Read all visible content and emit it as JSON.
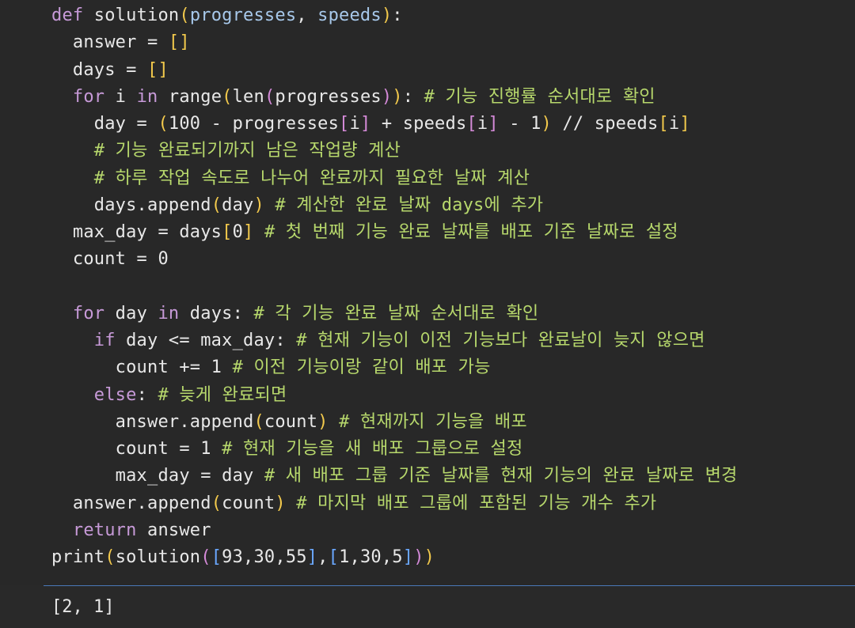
{
  "theme": {
    "background": "#282828",
    "output_background": "#292929",
    "divider": "#4a78b8",
    "colors": {
      "keyword": "#c79ad8",
      "function": "#e6e6e6",
      "param": "#a7c8ea",
      "bracket1": "#f2c94c",
      "bracket2": "#d48ad8",
      "bracket3": "#6aa7ff",
      "comment": "#b7d86c",
      "number": "#d8d8d8",
      "text": "#e8e8e8"
    }
  },
  "code_lines": [
    [
      {
        "t": "def",
        "c": "keyword"
      },
      {
        "t": " solution",
        "c": "function"
      },
      {
        "t": "(",
        "c": "bracket1"
      },
      {
        "t": "progresses",
        "c": "param"
      },
      {
        "t": ", ",
        "c": "text"
      },
      {
        "t": "speeds",
        "c": "param"
      },
      {
        "t": ")",
        "c": "bracket1"
      },
      {
        "t": ":",
        "c": "text"
      }
    ],
    [
      {
        "t": "  answer = ",
        "c": "text"
      },
      {
        "t": "[]",
        "c": "bracket1"
      }
    ],
    [
      {
        "t": "  days = ",
        "c": "text"
      },
      {
        "t": "[]",
        "c": "bracket1"
      }
    ],
    [
      {
        "t": "  ",
        "c": "text"
      },
      {
        "t": "for",
        "c": "keyword"
      },
      {
        "t": " i ",
        "c": "text"
      },
      {
        "t": "in",
        "c": "keyword"
      },
      {
        "t": " range",
        "c": "text"
      },
      {
        "t": "(",
        "c": "bracket1"
      },
      {
        "t": "len",
        "c": "text"
      },
      {
        "t": "(",
        "c": "bracket2"
      },
      {
        "t": "progresses",
        "c": "text"
      },
      {
        "t": ")",
        "c": "bracket2"
      },
      {
        "t": ")",
        "c": "bracket1"
      },
      {
        "t": ": ",
        "c": "text"
      },
      {
        "t": "# 기능 진행률 순서대로 확인",
        "c": "comment"
      }
    ],
    [
      {
        "t": "    day = ",
        "c": "text"
      },
      {
        "t": "(",
        "c": "bracket1"
      },
      {
        "t": "100 - progresses",
        "c": "text"
      },
      {
        "t": "[",
        "c": "bracket2"
      },
      {
        "t": "i",
        "c": "text"
      },
      {
        "t": "]",
        "c": "bracket2"
      },
      {
        "t": " + speeds",
        "c": "text"
      },
      {
        "t": "[",
        "c": "bracket2"
      },
      {
        "t": "i",
        "c": "text"
      },
      {
        "t": "]",
        "c": "bracket2"
      },
      {
        "t": " - 1",
        "c": "text"
      },
      {
        "t": ")",
        "c": "bracket1"
      },
      {
        "t": " // speeds",
        "c": "text"
      },
      {
        "t": "[",
        "c": "bracket1"
      },
      {
        "t": "i",
        "c": "text"
      },
      {
        "t": "]",
        "c": "bracket1"
      }
    ],
    [
      {
        "t": "    # 기능 완료되기까지 남은 작업량 계산",
        "c": "comment"
      }
    ],
    [
      {
        "t": "    # 하루 작업 속도로 나누어 완료까지 필요한 날짜 계산",
        "c": "comment"
      }
    ],
    [
      {
        "t": "    days.append",
        "c": "text"
      },
      {
        "t": "(",
        "c": "bracket1"
      },
      {
        "t": "day",
        "c": "text"
      },
      {
        "t": ")",
        "c": "bracket1"
      },
      {
        "t": " ",
        "c": "text"
      },
      {
        "t": "# 계산한 완료 날짜 days에 추가",
        "c": "comment"
      }
    ],
    [
      {
        "t": "  max_day = days",
        "c": "text"
      },
      {
        "t": "[",
        "c": "bracket1"
      },
      {
        "t": "0",
        "c": "text"
      },
      {
        "t": "]",
        "c": "bracket1"
      },
      {
        "t": " ",
        "c": "text"
      },
      {
        "t": "# 첫 번째 기능 완료 날짜를 배포 기준 날짜로 설정",
        "c": "comment"
      }
    ],
    [
      {
        "t": "  count = 0",
        "c": "text"
      }
    ],
    [
      {
        "t": "",
        "c": "text"
      }
    ],
    [
      {
        "t": "  ",
        "c": "text"
      },
      {
        "t": "for",
        "c": "keyword"
      },
      {
        "t": " day ",
        "c": "text"
      },
      {
        "t": "in",
        "c": "keyword"
      },
      {
        "t": " days: ",
        "c": "text"
      },
      {
        "t": "# 각 기능 완료 날짜 순서대로 확인",
        "c": "comment"
      }
    ],
    [
      {
        "t": "    ",
        "c": "text"
      },
      {
        "t": "if",
        "c": "keyword"
      },
      {
        "t": " day <= max_day: ",
        "c": "text"
      },
      {
        "t": "# 현재 기능이 이전 기능보다 완료날이 늦지 않으면",
        "c": "comment"
      }
    ],
    [
      {
        "t": "      count += 1 ",
        "c": "text"
      },
      {
        "t": "# 이전 기능이랑 같이 배포 가능",
        "c": "comment"
      }
    ],
    [
      {
        "t": "    ",
        "c": "text"
      },
      {
        "t": "else",
        "c": "keyword"
      },
      {
        "t": ": ",
        "c": "text"
      },
      {
        "t": "# 늦게 완료되면",
        "c": "comment"
      }
    ],
    [
      {
        "t": "      answer.append",
        "c": "text"
      },
      {
        "t": "(",
        "c": "bracket1"
      },
      {
        "t": "count",
        "c": "text"
      },
      {
        "t": ")",
        "c": "bracket1"
      },
      {
        "t": " ",
        "c": "text"
      },
      {
        "t": "# 현재까지 기능을 배포",
        "c": "comment"
      }
    ],
    [
      {
        "t": "      count = 1 ",
        "c": "text"
      },
      {
        "t": "# 현재 기능을 새 배포 그룹으로 설정",
        "c": "comment"
      }
    ],
    [
      {
        "t": "      max_day = day ",
        "c": "text"
      },
      {
        "t": "# 새 배포 그룹 기준 날짜를 현재 기능의 완료 날짜로 변경",
        "c": "comment"
      }
    ],
    [
      {
        "t": "  answer.append",
        "c": "text"
      },
      {
        "t": "(",
        "c": "bracket1"
      },
      {
        "t": "count",
        "c": "text"
      },
      {
        "t": ")",
        "c": "bracket1"
      },
      {
        "t": " ",
        "c": "text"
      },
      {
        "t": "# 마지막 배포 그룹에 포함된 기능 개수 추가",
        "c": "comment"
      }
    ],
    [
      {
        "t": "  ",
        "c": "text"
      },
      {
        "t": "return",
        "c": "keyword"
      },
      {
        "t": " answer",
        "c": "text"
      }
    ],
    [
      {
        "t": "print",
        "c": "text"
      },
      {
        "t": "(",
        "c": "bracket1"
      },
      {
        "t": "solution",
        "c": "text"
      },
      {
        "t": "(",
        "c": "bracket2"
      },
      {
        "t": "[",
        "c": "bracket3"
      },
      {
        "t": "93,30,55",
        "c": "text"
      },
      {
        "t": "]",
        "c": "bracket3"
      },
      {
        "t": ",",
        "c": "text"
      },
      {
        "t": "[",
        "c": "bracket3"
      },
      {
        "t": "1,30,5",
        "c": "text"
      },
      {
        "t": "]",
        "c": "bracket3"
      },
      {
        "t": ")",
        "c": "bracket2"
      },
      {
        "t": ")",
        "c": "bracket1"
      }
    ]
  ],
  "output": {
    "text": "[2, 1]"
  }
}
